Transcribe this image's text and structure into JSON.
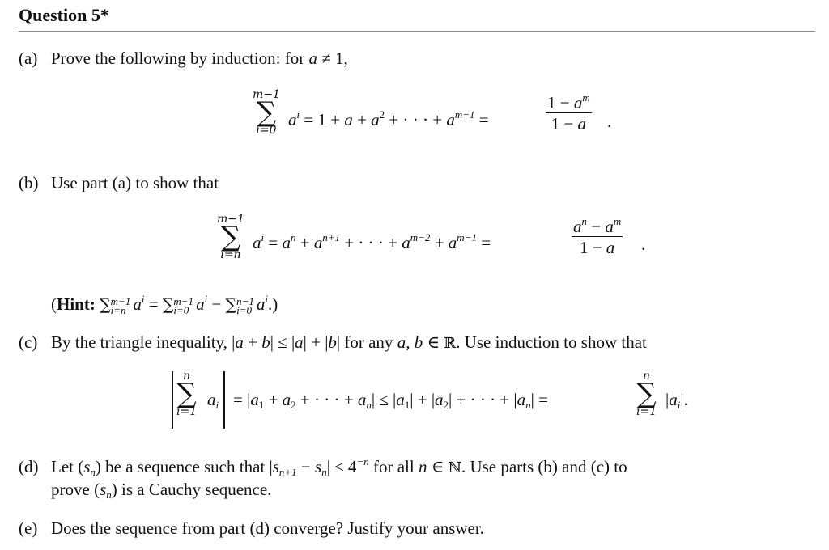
{
  "title": "Question 5*",
  "parts": {
    "a": {
      "label": "(a)",
      "text": "Prove the following by induction: for ",
      "cond_var": "a",
      "cond_rest": " ≠ 1,",
      "formula": {
        "sum_upper": "m−1",
        "sum_lower": "i=0",
        "term": "a",
        "term_exp": "i",
        "expansion_1": "= 1 + ",
        "expansion_a": "a",
        "expansion_2": " + ",
        "expansion_a2": "a",
        "expansion_a2_exp": "2",
        "expansion_3": " + · · · + ",
        "expansion_last": "a",
        "expansion_last_exp": "m−1",
        "equals": "=",
        "frac_num_1": "1 − ",
        "frac_num_var": "a",
        "frac_num_exp": "m",
        "frac_den_1": "1 − ",
        "frac_den_var": "a",
        "end": "."
      }
    },
    "b": {
      "label": "(b)",
      "text": "Use part (a) to show that",
      "formula": {
        "sum_upper": "m−1",
        "sum_lower": "i=n",
        "term": "a",
        "term_exp": "i",
        "expansion": [
          {
            "pre": "= ",
            "base": "a",
            "exp": "n"
          },
          {
            "pre": " + ",
            "base": "a",
            "exp": "n+1"
          },
          {
            "pre": " + · · · + ",
            "base": "a",
            "exp": "m−2"
          },
          {
            "pre": " + ",
            "base": "a",
            "exp": "m−1"
          }
        ],
        "equals": "=",
        "frac_num_a": "a",
        "frac_num_a_exp": "n",
        "frac_num_minus": " − ",
        "frac_num_b": "a",
        "frac_num_b_exp": "m",
        "frac_den_1": "1 − ",
        "frac_den_var": "a",
        "end": "."
      },
      "hint": {
        "open": "(",
        "label": "Hint:",
        "sum1_upper": "m−1",
        "sum1_lower": "i=n",
        "sum2_upper": "m−1",
        "sum2_lower": "i=0",
        "sum3_upper": "n−1",
        "sum3_lower": "i=0",
        "sigma": "∑",
        "term": "a",
        "term_exp": "i",
        "equals": " = ",
        "minus": " − ",
        "close": ".)"
      }
    },
    "c": {
      "label": "(c)",
      "text_1": "By the triangle inequality, |",
      "var_a": "a",
      "text_2": " + ",
      "var_b": "b",
      "text_3": "| ≤ |",
      "var_a2": "a",
      "text_4": "| + |",
      "var_b2": "b",
      "text_5": "| for any ",
      "var_ab": "a, b",
      "text_6": " ∈ ",
      "reals": "ℝ",
      "text_7": ". Use induction to show that",
      "formula": {
        "sum_upper": "n",
        "sum_lower": "i=1",
        "term": "a",
        "term_sub": "i",
        "middle": [
          {
            "pre": "= |",
            "base": "a",
            "sub": "1"
          },
          {
            "pre": " + ",
            "base": "a",
            "sub": "2"
          },
          {
            "pre": " + · · · + ",
            "base": "a",
            "sub": "n"
          },
          {
            "pre": "| ≤ |",
            "base": "a",
            "sub": "1"
          },
          {
            "pre": "| + |",
            "base": "a",
            "sub": "2"
          },
          {
            "pre": "| + · · · + |",
            "base": "a",
            "sub": "n"
          }
        ],
        "middle_end": "| =",
        "sum2_upper": "n",
        "sum2_lower": "i=1",
        "tail_open": "|",
        "tail_base": "a",
        "tail_sub": "i",
        "tail_close": "|."
      }
    },
    "d": {
      "label": "(d)",
      "text_1": "Let (",
      "s": "s",
      "s_sub": "n",
      "text_2": ") be a sequence such that |",
      "s2_sub": "n+1",
      "text_3": " − ",
      "s3_sub": "n",
      "text_4": "| ≤ 4",
      "pow": "−n",
      "text_5": " for all ",
      "n": "n",
      "text_6": " ∈ ",
      "naturals": "ℕ",
      "text_7": ". Use parts (b) and (c) to",
      "line2_1": "prove (",
      "line2_sub": "n",
      "line2_2": ") is a Cauchy sequence."
    },
    "e": {
      "label": "(e)",
      "text": "Does the sequence from part (d) converge? Justify your answer."
    }
  }
}
